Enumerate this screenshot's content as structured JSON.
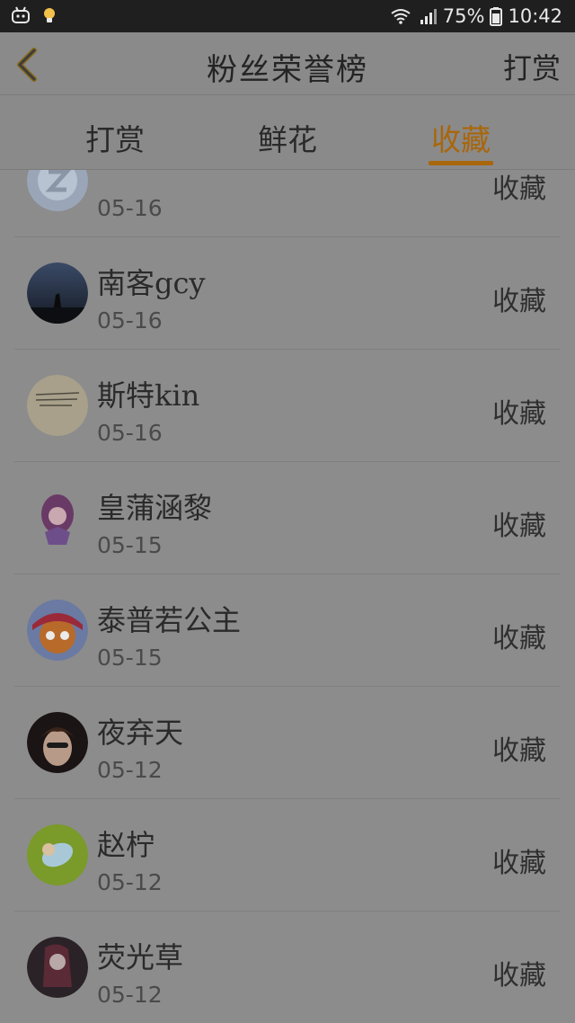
{
  "status_bar": {
    "battery": "75%",
    "time": "10:42"
  },
  "header": {
    "title": "粉丝荣誉榜",
    "action": "打赏"
  },
  "tabs": [
    {
      "label": "打赏",
      "active": false
    },
    {
      "label": "鲜花",
      "active": false
    },
    {
      "label": "收藏",
      "active": true
    }
  ],
  "accent_color": "#a9660b",
  "fans": [
    {
      "name": "",
      "date": "05-16",
      "action": "收藏"
    },
    {
      "name": "南客gcy",
      "date": "05-16",
      "action": "收藏"
    },
    {
      "name": "斯特kin",
      "date": "05-16",
      "action": "收藏"
    },
    {
      "name": "皇蒲涵黎",
      "date": "05-15",
      "action": "收藏"
    },
    {
      "name": "泰普若公主",
      "date": "05-15",
      "action": "收藏"
    },
    {
      "name": "夜弃天",
      "date": "05-12",
      "action": "收藏"
    },
    {
      "name": "赵柠",
      "date": "05-12",
      "action": "收藏"
    },
    {
      "name": "荧光草",
      "date": "05-12",
      "action": "收藏"
    }
  ]
}
